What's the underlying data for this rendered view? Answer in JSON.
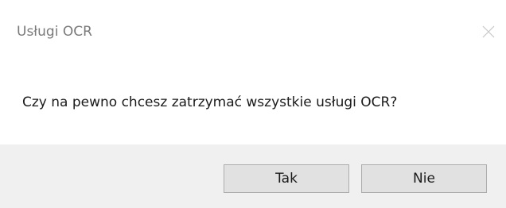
{
  "window": {
    "title": "Usługi OCR",
    "close_icon": "close-icon"
  },
  "message": "Czy na pewno chcesz zatrzymać wszystkie usługi OCR?",
  "buttons": {
    "yes_label": "Tak",
    "no_label": "Nie"
  },
  "colors": {
    "title_text": "#7a7a7a",
    "footer_bg": "#f0f0f0",
    "button_bg": "#e1e1e1",
    "button_border": "#adadad"
  }
}
